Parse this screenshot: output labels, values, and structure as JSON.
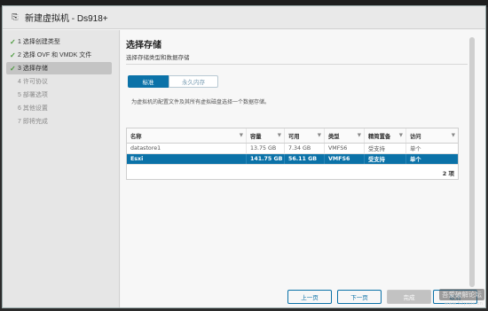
{
  "window": {
    "title": "新建虚拟机 - Ds918+",
    "icon": "vm-add-icon"
  },
  "sidebar": {
    "steps": [
      {
        "label": "1 选择创建类型",
        "state": "done"
      },
      {
        "label": "2 选择 OVF 和 VMDK 文件",
        "state": "done"
      },
      {
        "label": "3 选择存储",
        "state": "active"
      },
      {
        "label": "4 许可协议",
        "state": "future"
      },
      {
        "label": "5 部署选项",
        "state": "future"
      },
      {
        "label": "6 其他设置",
        "state": "future"
      },
      {
        "label": "7 即将完成",
        "state": "future"
      }
    ]
  },
  "main": {
    "title": "选择存储",
    "subtitle": "选择存储类型和数据存储",
    "tabs": [
      {
        "label": "标准",
        "selected": true
      },
      {
        "label": "永久内存",
        "selected": false
      }
    ],
    "description": "为虚拟机的配置文件及其所有虚拟磁盘选择一个数据存储。",
    "table": {
      "columns": [
        "名称",
        "容量",
        "可用",
        "类型",
        "精简置备",
        "访问"
      ],
      "rows": [
        [
          "datastore1",
          "13.75 GB",
          "7.34 GB",
          "VMFS6",
          "受支持",
          "单个"
        ],
        [
          "Esxi",
          "141.75 GB",
          "56.11 GB",
          "VMFS6",
          "受支持",
          "单个"
        ]
      ],
      "selected_row": 1,
      "count": "2 项"
    }
  },
  "footer": {
    "prev": "上一页",
    "next": "下一页",
    "finish": "完成",
    "cancel": "取消"
  },
  "watermark": {
    "line1": "吾爱破解论坛",
    "line2": "www.52pojie.cn"
  },
  "colors": {
    "accent": "#0b72a8",
    "check": "#4b9a3d"
  }
}
